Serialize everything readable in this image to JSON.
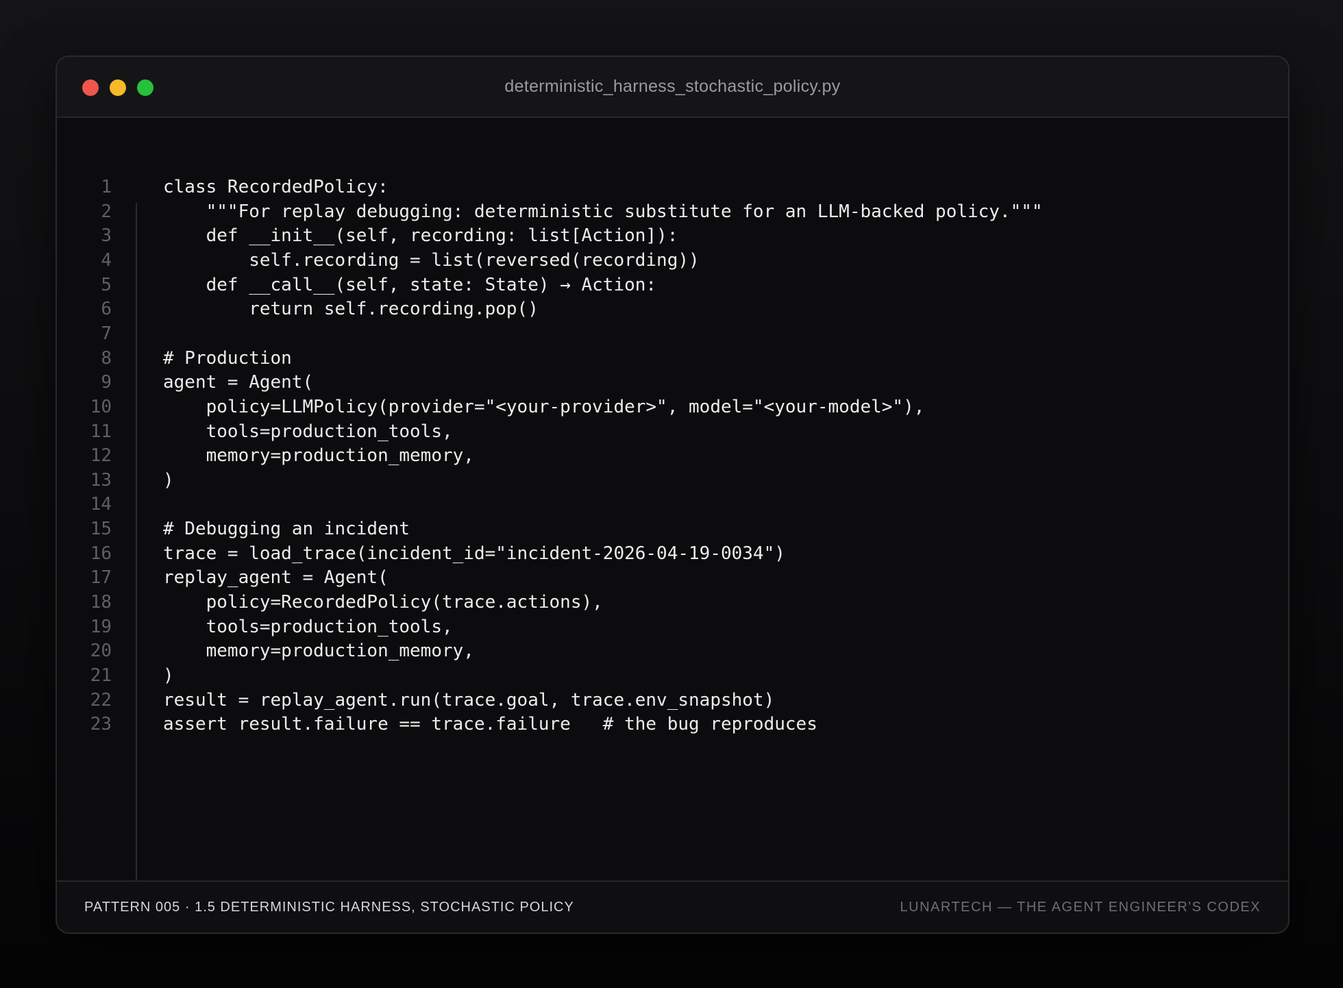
{
  "window": {
    "title": "deterministic_harness_stochastic_policy.py",
    "controls": [
      "close",
      "minimize",
      "maximize"
    ]
  },
  "code": {
    "lines": [
      {
        "number": "1",
        "text": "class RecordedPolicy:"
      },
      {
        "number": "2",
        "text": "    \"\"\"For replay debugging: deterministic substitute for an LLM-backed policy.\"\"\""
      },
      {
        "number": "3",
        "text": "    def __init__(self, recording: list[Action]):"
      },
      {
        "number": "4",
        "text": "        self.recording = list(reversed(recording))"
      },
      {
        "number": "5",
        "text": "    def __call__(self, state: State) → Action:"
      },
      {
        "number": "6",
        "text": "        return self.recording.pop()"
      },
      {
        "number": "7",
        "text": ""
      },
      {
        "number": "8",
        "text": "# Production"
      },
      {
        "number": "9",
        "text": "agent = Agent("
      },
      {
        "number": "10",
        "text": "    policy=LLMPolicy(provider=\"<your-provider>\", model=\"<your-model>\"),"
      },
      {
        "number": "11",
        "text": "    tools=production_tools,"
      },
      {
        "number": "12",
        "text": "    memory=production_memory,"
      },
      {
        "number": "13",
        "text": ")"
      },
      {
        "number": "14",
        "text": ""
      },
      {
        "number": "15",
        "text": "# Debugging an incident"
      },
      {
        "number": "16",
        "text": "trace = load_trace(incident_id=\"incident-2026-04-19-0034\")"
      },
      {
        "number": "17",
        "text": "replay_agent = Agent("
      },
      {
        "number": "18",
        "text": "    policy=RecordedPolicy(trace.actions),"
      },
      {
        "number": "19",
        "text": "    tools=production_tools,"
      },
      {
        "number": "20",
        "text": "    memory=production_memory,"
      },
      {
        "number": "21",
        "text": ")"
      },
      {
        "number": "22",
        "text": "result = replay_agent.run(trace.goal, trace.env_snapshot)"
      },
      {
        "number": "23",
        "text": "assert result.failure == trace.failure   # the bug reproduces"
      }
    ]
  },
  "footer": {
    "left": "PATTERN 005 · 1.5 DETERMINISTIC HARNESS, STOCHASTIC POLICY",
    "right": "LUNARTECH — THE AGENT ENGINEER'S CODEX"
  },
  "colors": {
    "close": "#f0564d",
    "minimize": "#f7b928",
    "maximize": "#27c13b",
    "code_text": "#ececec",
    "line_number": "#5f5f66"
  }
}
